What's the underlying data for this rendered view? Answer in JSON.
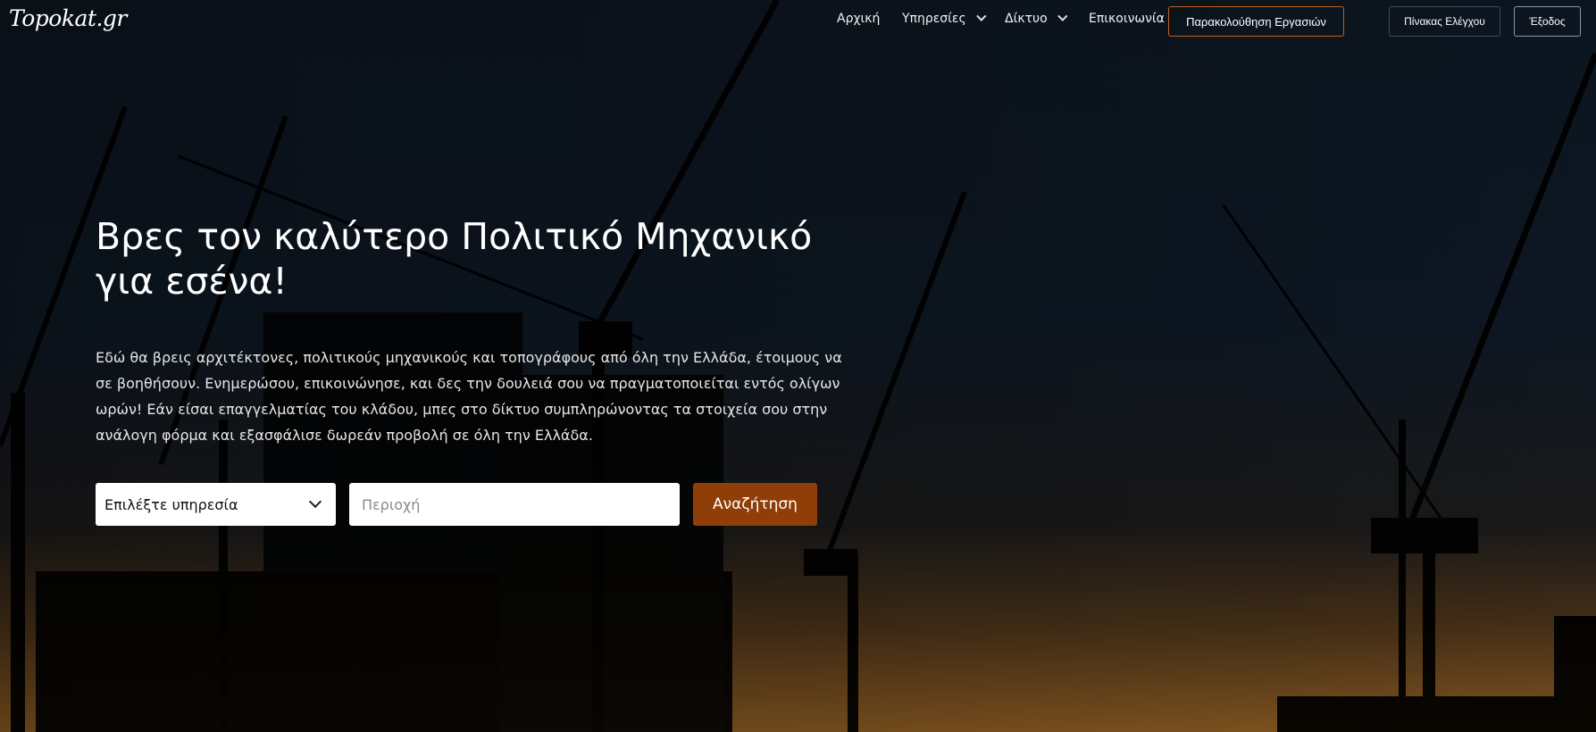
{
  "brand": {
    "logo_text": "Topokat.gr"
  },
  "nav": {
    "items": [
      {
        "label": "Αρχική"
      },
      {
        "label": "Υπηρεσίες"
      },
      {
        "label": "Δίκτυο"
      },
      {
        "label": "Επικοινωνία"
      }
    ],
    "track_button": "Παρακολούθηση Εργασιών",
    "dashboard_button": "Πίνακας Ελέγχου",
    "logout_button": "Έξοδος"
  },
  "hero": {
    "headline": "Βρες τον καλύτερο Πολιτικό Μηχανικό για εσένα!",
    "description": "Εδώ θα βρεις αρχιτέκτονες, πολιτικούς μηχανικούς και τοπογράφους από όλη την Ελλάδα, έτοιμους να σε βοηθήσουν. Ενημερώσου, επικοινώνησε, και δες την δουλειά σου να πραγματοποιείται εντός ολίγων ωρών! Εάν είσαι επαγγελματίας του κλάδου, μπες στο δίκτυο συμπληρώνοντας τα στοιχεία σου στην ανάλογη φόρμα και εξασφάλισε δωρεάν προβολή σε όλη την Ελλάδα."
  },
  "search": {
    "service_selected": "Επιλέξτε υπηρεσία",
    "region_placeholder": "Περιοχή",
    "region_value": "",
    "submit_label": "Αναζήτηση"
  },
  "colors": {
    "accent": "#8e3e06",
    "track_border": "#c1601d",
    "sky_top": "#0d1621",
    "sunset": "#8a5a22"
  },
  "icons": {
    "services_dropdown": "chevron-down-icon",
    "network_dropdown": "chevron-down-icon",
    "service_select": "chevron-down-icon"
  }
}
